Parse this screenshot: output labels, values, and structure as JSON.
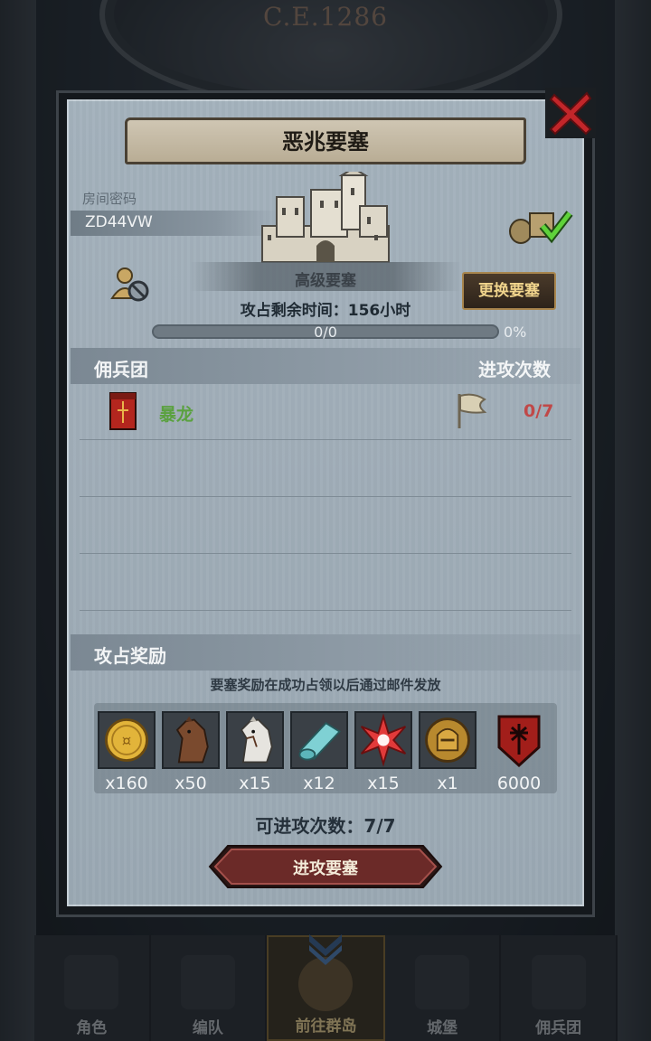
{
  "era": "C.E.1286",
  "dialog": {
    "title": "恶兆要塞",
    "room_code_label": "房间密码",
    "room_code": "ZD44VW",
    "fortress_level": "高级要塞",
    "change_button": "更换要塞",
    "time_remaining": "攻占剩余时间：156小时",
    "progress": {
      "text": "0/0",
      "percent_text": "0%",
      "fraction": 0
    },
    "mercenary_header": "佣兵团",
    "attack_count_header": "进攻次数",
    "mercenaries": [
      {
        "name": "暴龙",
        "attacks": "0/7"
      }
    ],
    "reward_header": "攻占奖励",
    "reward_note": "要塞奖励在成功占领以后通过邮件发放",
    "rewards": [
      {
        "icon": "gold-coin-icon",
        "qty": "x160"
      },
      {
        "icon": "brown-horse-icon",
        "qty": "x50"
      },
      {
        "icon": "white-horse-icon",
        "qty": "x15"
      },
      {
        "icon": "cloth-bolt-icon",
        "qty": "x12"
      },
      {
        "icon": "red-star-icon",
        "qty": "x15"
      },
      {
        "icon": "knight-helmet-medal-icon",
        "qty": "x1"
      },
      {
        "icon": "red-shield-emblem-icon",
        "qty": "6000"
      }
    ],
    "remaining_attacks": "可进攻次数：7/7",
    "attack_button": "进攻要塞"
  },
  "nav": {
    "items": [
      {
        "label": "角色"
      },
      {
        "label": "编队"
      },
      {
        "label": "前往群岛",
        "active": true
      },
      {
        "label": "城堡"
      },
      {
        "label": "佣兵团"
      }
    ]
  },
  "colors": {
    "panel": "#a1aeb9",
    "accent_gold": "#f0d48c",
    "merc_name_green": "#5aa13f",
    "attack_count_red": "#c04848",
    "attack_button": "#6b2a28"
  }
}
